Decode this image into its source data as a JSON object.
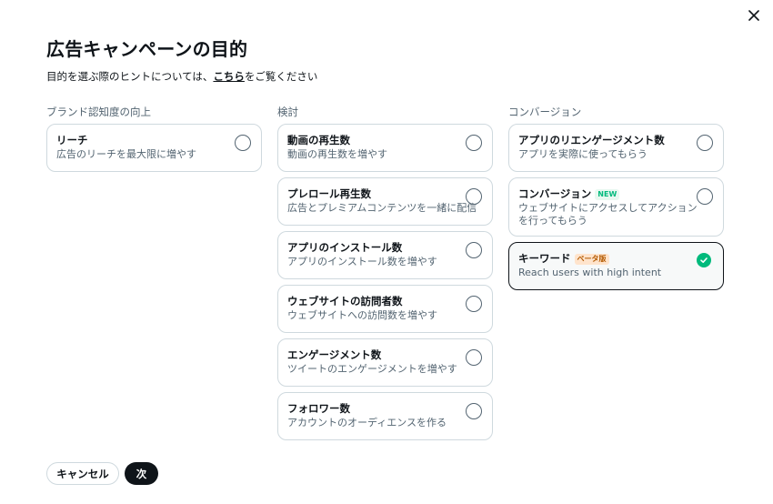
{
  "dialog": {
    "title": "広告キャンペーンの目的",
    "hint_prefix": "目的を選ぶ際のヒントについては、",
    "hint_link": "こちら",
    "hint_suffix": "をご覧ください"
  },
  "columns": [
    {
      "heading": "ブランド認知度の向上",
      "options": [
        {
          "title": "リーチ",
          "desc": "広告のリーチを最大限に増やす",
          "selected": false
        }
      ]
    },
    {
      "heading": "検討",
      "options": [
        {
          "title": "動画の再生数",
          "desc": "動画の再生数を増やす",
          "selected": false
        },
        {
          "title": "プレロール再生数",
          "desc": "広告とプレミアムコンテンツを一緒に配信",
          "selected": false
        },
        {
          "title": "アプリのインストール数",
          "desc": "アプリのインストール数を増やす",
          "selected": false
        },
        {
          "title": "ウェブサイトの訪問者数",
          "desc": "ウェブサイトへの訪問数を増やす",
          "selected": false
        },
        {
          "title": "エンゲージメント数",
          "desc": "ツイートのエンゲージメントを増やす",
          "selected": false
        },
        {
          "title": "フォロワー数",
          "desc": "アカウントのオーディエンスを作る",
          "selected": false
        }
      ]
    },
    {
      "heading": "コンバージョン",
      "options": [
        {
          "title": "アプリのリエンゲージメント数",
          "desc": "アプリを実際に使ってもらう",
          "selected": false
        },
        {
          "title": "コンバージョン",
          "badge": "NEW",
          "desc": "ウェブサイトにアクセスしてアクションを行ってもらう",
          "selected": false
        },
        {
          "title": "キーワード",
          "badge": "ベータ版",
          "desc": "Reach users with high intent",
          "selected": true
        }
      ]
    }
  ],
  "footer": {
    "cancel_label": "キャンセル",
    "next_label": "次"
  },
  "colors": {
    "accent_check": "#00ba7c",
    "primary_button": "#0f1419",
    "border": "#cfd9de"
  },
  "icons": {
    "close": "close-icon",
    "radio": "radio-icon",
    "check": "check-icon"
  }
}
